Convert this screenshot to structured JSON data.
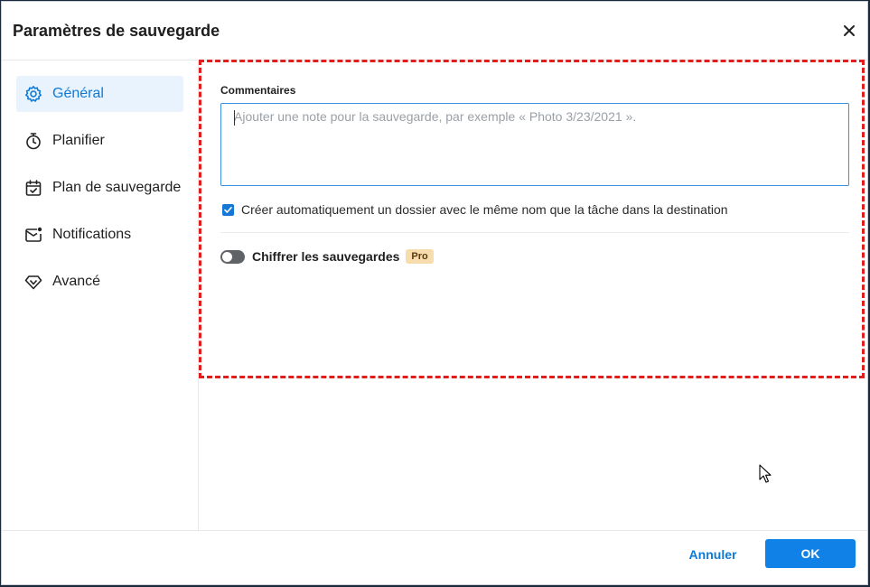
{
  "dialog": {
    "title": "Paramètres de sauvegarde"
  },
  "sidebar": {
    "items": [
      {
        "label": "Général",
        "icon": "gear-icon",
        "active": true
      },
      {
        "label": "Planifier",
        "icon": "stopwatch-icon",
        "active": false
      },
      {
        "label": "Plan de sauvegarde",
        "icon": "calendar-check-icon",
        "active": false
      },
      {
        "label": "Notifications",
        "icon": "mail-notification-icon",
        "active": false
      },
      {
        "label": "Avancé",
        "icon": "diamond-icon",
        "active": false
      }
    ]
  },
  "general": {
    "comments_label": "Commentaires",
    "comments_value": "",
    "comments_placeholder": "Ajouter une note pour la sauvegarde, par exemple « Photo 3/23/2021 ».",
    "auto_folder_label": "Créer automatiquement un dossier avec le même nom que la tâche dans la destination",
    "auto_folder_checked": true,
    "encrypt_label": "Chiffrer les sauvegardes",
    "encrypt_enabled": false,
    "pro_badge": "Pro"
  },
  "footer": {
    "cancel_label": "Annuler",
    "ok_label": "OK"
  },
  "colors": {
    "accent": "#1081e6",
    "active_bg": "#e9f3fd",
    "highlight_border": "#e01e1e",
    "pro_badge_bg": "#f7dcae"
  }
}
